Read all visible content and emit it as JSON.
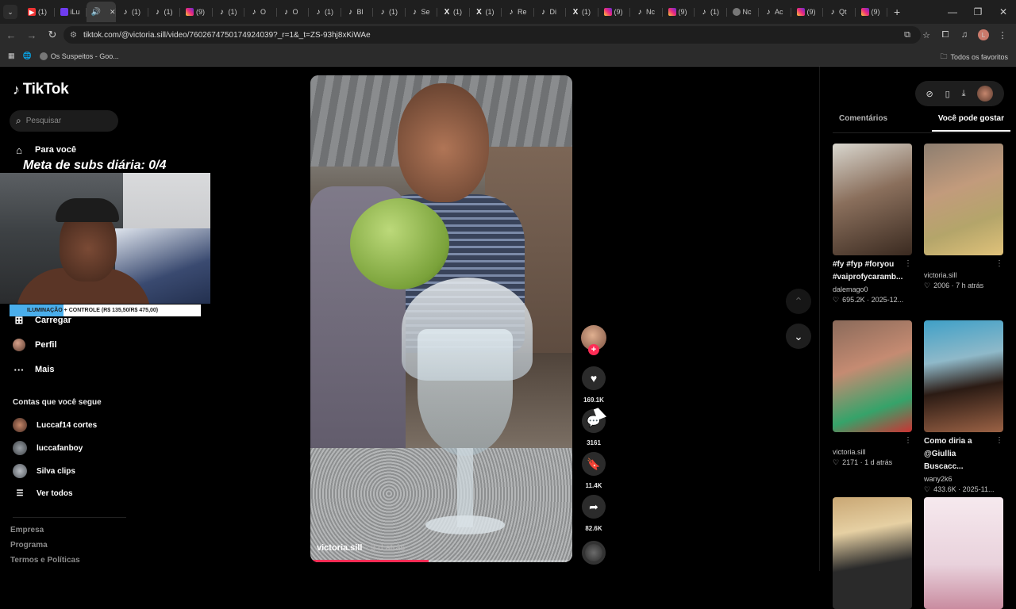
{
  "browser": {
    "tabs": [
      {
        "icon": "youtube",
        "label": "(1)"
      },
      {
        "icon": "twitch",
        "label": "iLu"
      },
      {
        "icon": "speaker",
        "label": ""
      },
      {
        "icon": "tiktok",
        "label": "(1)"
      },
      {
        "icon": "tiktok",
        "label": "(1)"
      },
      {
        "icon": "instagram",
        "label": "(9)"
      },
      {
        "icon": "tiktok",
        "label": "(1)"
      },
      {
        "icon": "tiktok",
        "label": "O"
      },
      {
        "icon": "tiktok",
        "label": "O"
      },
      {
        "icon": "tiktok",
        "label": "(1)"
      },
      {
        "icon": "tiktok",
        "label": "Bl"
      },
      {
        "icon": "tiktok",
        "label": "(1)"
      },
      {
        "icon": "tiktok",
        "label": "Se"
      },
      {
        "icon": "x",
        "label": "(1)"
      },
      {
        "icon": "x",
        "label": "(1)"
      },
      {
        "icon": "tiktok",
        "label": "Re"
      },
      {
        "icon": "tiktok",
        "label": "Di"
      },
      {
        "icon": "x",
        "label": "(1)"
      },
      {
        "icon": "instagram",
        "label": "(9)"
      },
      {
        "icon": "tiktok",
        "label": "Nc"
      },
      {
        "icon": "instagram",
        "label": "(9)"
      },
      {
        "icon": "tiktok",
        "label": "(1)"
      },
      {
        "icon": "globe",
        "label": "Nc"
      },
      {
        "icon": "tiktok",
        "label": "Ac"
      },
      {
        "icon": "instagram",
        "label": "(9)"
      },
      {
        "icon": "tiktok",
        "label": "Qt"
      },
      {
        "icon": "instagram",
        "label": "(9)"
      }
    ],
    "url": "tiktok.com/@victoria.sill/video/7602674750174924039?_r=1&_t=ZS-93hj8xKiWAe",
    "bookmark": "Os Suspeitos - Goo...",
    "all_favorites": "Todos os favoritos",
    "profile_initial": "L"
  },
  "sidebar": {
    "brand": "TikTok",
    "search_placeholder": "Pesquisar",
    "menu": {
      "for_you": "Para você",
      "upload": "Carregar",
      "profile": "Perfil",
      "more": "Mais"
    },
    "following_title": "Contas que você segue",
    "following": [
      {
        "name": "Luccaf14 cortes"
      },
      {
        "name": "luccafanboy"
      },
      {
        "name": "Silva clips"
      }
    ],
    "see_all": "Ver todos",
    "footer": [
      "Empresa",
      "Programa",
      "Termos e Políticas"
    ]
  },
  "overlay": {
    "goal_text": "Meta de subs diária: 0/4",
    "banner_text": "ILUMINAÇÃO + CONTROLE (R$ 135,50/R$ 475,00)"
  },
  "video": {
    "author": "victoria.sill",
    "time_ago": "· 3 d atrás",
    "progress": 0.45
  },
  "actions": {
    "likes": "169.1K",
    "comments": "3161",
    "saves": "11.4K",
    "shares": "82.6K"
  },
  "right_panel": {
    "tabs": {
      "comments": "Comentários",
      "you_may_like": "Você pode gostar"
    },
    "cards": [
      {
        "title": "#fy #fyp #foryou #vaiprofycaramb...",
        "author": "dalemago0",
        "stats": "695.2K · 2025-12..."
      },
      {
        "title": "",
        "author": "victoria.sill",
        "stats": "2006 · 7 h atrás"
      },
      {
        "title": "",
        "author": "victoria.sill",
        "stats": "2171 · 1 d atrás"
      },
      {
        "title": "Como diria a @Giullia Buscacc...",
        "author": "wany2k6",
        "stats": "433.6K · 2025-11..."
      }
    ]
  }
}
